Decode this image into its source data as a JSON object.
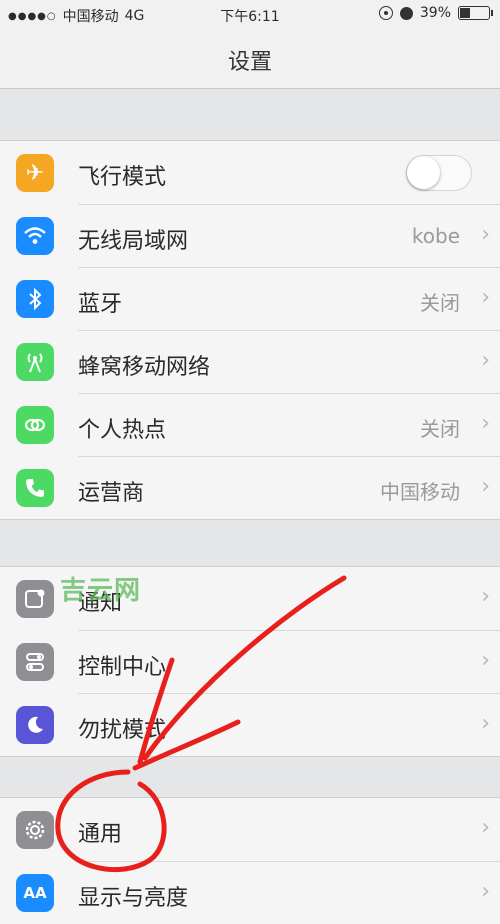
{
  "status_bar": {
    "carrier": "中国移动",
    "network": "4G",
    "time": "下午6:11",
    "battery": "39%"
  },
  "nav": {
    "title": "设置"
  },
  "groups": [
    {
      "items": [
        {
          "label": "飞行模式",
          "icon": "airplane-icon",
          "color": "#f5a623",
          "toggle": false
        },
        {
          "label": "无线局域网",
          "icon": "wifi-icon",
          "color": "#1a8cff",
          "value": "kobe"
        },
        {
          "label": "蓝牙",
          "icon": "bluetooth-icon",
          "color": "#1a8cff",
          "value": "关闭"
        },
        {
          "label": "蜂窝移动网络",
          "icon": "cellular-icon",
          "color": "#4cd964",
          "value": ""
        },
        {
          "label": "个人热点",
          "icon": "hotspot-icon",
          "color": "#4cd964",
          "value": "关闭"
        },
        {
          "label": "运营商",
          "icon": "phone-icon",
          "color": "#4cd964",
          "value": "中国移动"
        }
      ]
    },
    {
      "items": [
        {
          "label": "通知",
          "icon": "notifications-icon",
          "color": "#8e8e93",
          "value": ""
        },
        {
          "label": "控制中心",
          "icon": "control-center-icon",
          "color": "#8e8e93",
          "value": ""
        },
        {
          "label": "勿扰模式",
          "icon": "moon-icon",
          "color": "#5856d6",
          "value": ""
        }
      ]
    },
    {
      "items": [
        {
          "label": "通用",
          "icon": "gear-icon",
          "color": "#8e8e93",
          "value": ""
        },
        {
          "label": "显示与亮度",
          "icon": "display-brightness-icon",
          "color": "#1a8cff",
          "value": ""
        }
      ]
    }
  ],
  "watermark": "吉云网",
  "chevron_glyph": "›",
  "colors": {
    "annotation_red": "#e8201c"
  }
}
